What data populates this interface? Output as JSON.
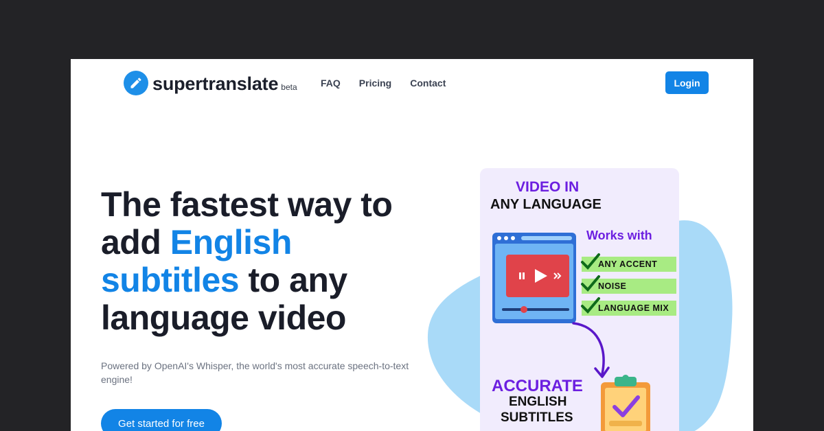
{
  "brand": {
    "name": "supertranslate",
    "badge": "beta"
  },
  "nav": {
    "items": [
      "FAQ",
      "Pricing",
      "Contact"
    ]
  },
  "header": {
    "login_label": "Login"
  },
  "hero": {
    "line1": "The fastest way to",
    "line2_pre": "add ",
    "line2_accent": "English",
    "line3_accent": "subtitles",
    "line3_post": " to any",
    "line4": "language video",
    "subtitle": "Powered by OpenAI's Whisper, the world's most accurate speech-to-text engine!",
    "cta_label": "Get started for free"
  },
  "illustration": {
    "title_line1": "VIDEO IN",
    "title_line2": "ANY LANGUAGE",
    "works_with": "Works with",
    "features": [
      "ANY ACCENT",
      "NOISE",
      "LANGUAGE MIX"
    ],
    "result_line1": "ACCURATE",
    "result_line2": "ENGLISH",
    "result_line3": "SUBTITLES"
  },
  "colors": {
    "accent": "#1284e6",
    "purple": "#6c1fe0",
    "tag_green": "#a8eb83",
    "card_bg": "#f1ecfd",
    "blob": "#a9daf8"
  }
}
